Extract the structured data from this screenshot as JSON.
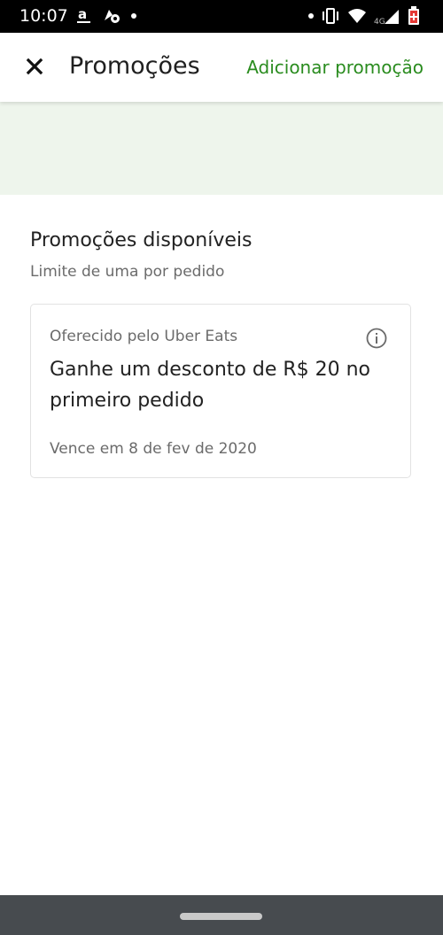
{
  "status_bar": {
    "time": "10:07",
    "left_icons": [
      "amazon-icon",
      "kite-icon",
      "notification-dot-icon"
    ],
    "right_icons": [
      "notification-dot-icon",
      "vibrate-icon",
      "wifi-icon",
      "signal-4g-icon",
      "battery-icon"
    ],
    "network_label": "4G"
  },
  "header": {
    "close_icon": "close-icon",
    "title": "Promoções",
    "action_label": "Adicionar promoção"
  },
  "content": {
    "section_title": "Promoções disponíveis",
    "section_subtitle": "Limite de uma por pedido",
    "promo": {
      "offered_by": "Oferecido pelo Uber Eats",
      "info_icon": "info-icon",
      "description": "Ganhe um desconto de R$ 20 no primeiro pedido",
      "expiry": "Vence em 8 de fev de 2020"
    }
  },
  "colors": {
    "accent": "#2a8c1f",
    "banner": "#eef5ec",
    "status_bar": "#000000",
    "nav_bar": "#474b4f",
    "battery": "#e53935"
  }
}
